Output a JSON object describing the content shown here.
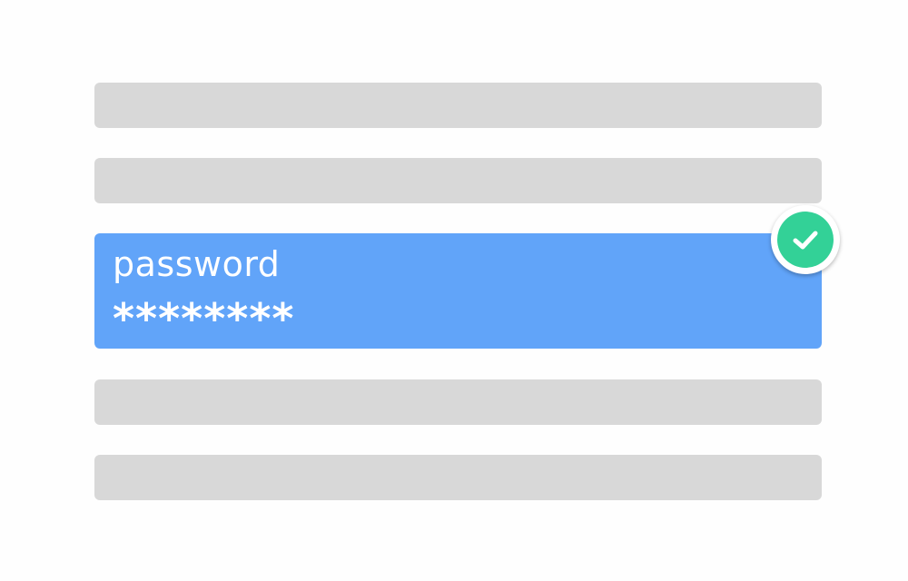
{
  "form": {
    "password_field": {
      "label": "password",
      "value": "********",
      "status_icon": "check-icon"
    },
    "empty_fields_count": 4
  },
  "colors": {
    "field_empty": "#d8d8d8",
    "field_active": "#61a4f9",
    "success": "#33d197",
    "text": "#ffffff"
  }
}
